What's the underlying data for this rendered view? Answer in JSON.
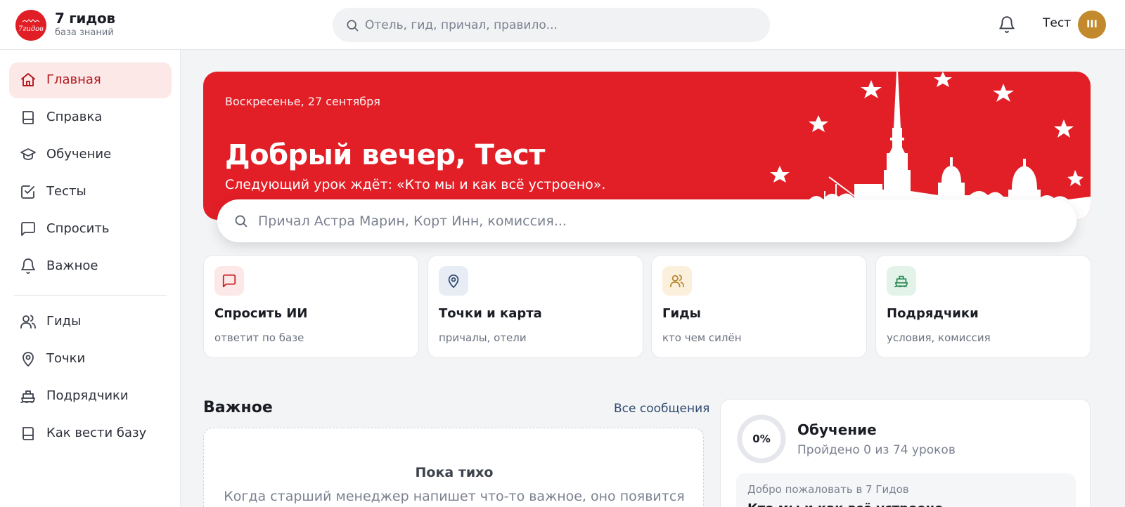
{
  "brand": {
    "name": "7 гидов",
    "subtitle": "база знаний",
    "logo_text": "7 гидов",
    "accent": "#e11d25"
  },
  "header": {
    "search_placeholder": "Отель, гид, причал, правило...",
    "user_name": "Тест",
    "avatar_text": "III",
    "icons": [
      "search-icon",
      "bell-icon"
    ]
  },
  "sidebar": {
    "items": [
      {
        "label": "Главная",
        "icon": "home-icon",
        "active": true
      },
      {
        "label": "Справка",
        "icon": "book-icon"
      },
      {
        "label": "Обучение",
        "icon": "graduation-cap-icon"
      },
      {
        "label": "Тесты",
        "icon": "checkbox-icon"
      },
      {
        "label": "Спросить",
        "icon": "chat-icon"
      },
      {
        "label": "Важное",
        "icon": "bell-icon"
      },
      {
        "label": "Гиды",
        "icon": "users-icon"
      },
      {
        "label": "Точки",
        "icon": "map-pin-icon"
      },
      {
        "label": "Подрядчики",
        "icon": "ship-icon"
      },
      {
        "label": "Как вести базу",
        "icon": "book-icon"
      }
    ]
  },
  "hero": {
    "date": "Воскресенье, 27 сентября",
    "title": "Добрый вечер, Тест",
    "subtitle": "Следующий урок ждёт: «Кто мы и как всё устроено».",
    "background": "#e21e26",
    "search_placeholder": "Причал Астра Марин, Корт Инн, комиссия..."
  },
  "cards": [
    {
      "title": "Спросить ИИ",
      "subtitle": "ответит по базе",
      "icon": "chat-icon",
      "icon_bg": "#fde8e8",
      "icon_color": "#c81e24"
    },
    {
      "title": "Точки и карта",
      "subtitle": "причалы, отели",
      "icon": "map-pin-icon",
      "icon_bg": "#e8edf5",
      "icon_color": "#2f4a6e"
    },
    {
      "title": "Гиды",
      "subtitle": "кто чем силён",
      "icon": "users-icon",
      "icon_bg": "#fbf0dc",
      "icon_color": "#b7862e"
    },
    {
      "title": "Подрядчики",
      "subtitle": "условия, комиссия",
      "icon": "ship-icon",
      "icon_bg": "#e3f3ea",
      "icon_color": "#2a8a55"
    }
  ],
  "important": {
    "title": "Важное",
    "link": "Все сообщения",
    "empty_title": "Пока тихо",
    "empty_text": "Когда старший менеджер напишет что-то важное, оно появится здесь и"
  },
  "learning": {
    "progress_label": "0%",
    "progress": 0,
    "title": "Обучение",
    "subtitle": "Пройдено 0 из 74 уроков",
    "welcome_label": "Добро пожаловать в 7 Гидов",
    "welcome_next": "Кто мы и как всё устроено"
  }
}
